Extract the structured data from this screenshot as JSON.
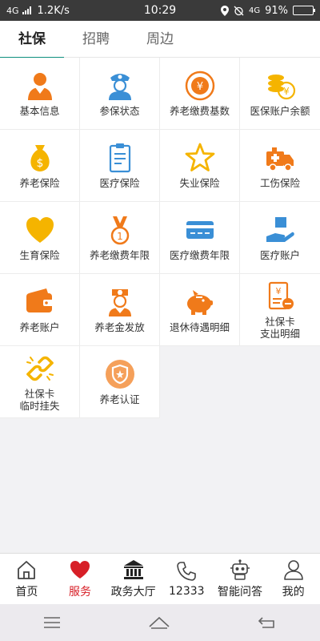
{
  "status": {
    "network": "4G",
    "speed": "1.2K/s",
    "time": "10:29",
    "network2": "4G",
    "battery": "91%",
    "battery_level": 0.91
  },
  "tabs": [
    {
      "label": "社保",
      "active": true
    },
    {
      "label": "招聘",
      "active": false
    },
    {
      "label": "周边",
      "active": false
    }
  ],
  "services": [
    {
      "label": "基本信息",
      "icon": "person-icon"
    },
    {
      "label": "参保状态",
      "icon": "officer-icon"
    },
    {
      "label": "养老缴费基数",
      "icon": "yen-circle-icon"
    },
    {
      "label": "医保账户余额",
      "icon": "coins-icon"
    },
    {
      "label": "养老保险",
      "icon": "money-bag-icon"
    },
    {
      "label": "医疗保险",
      "icon": "clipboard-icon"
    },
    {
      "label": "失业保险",
      "icon": "star-icon"
    },
    {
      "label": "工伤保险",
      "icon": "ambulance-icon"
    },
    {
      "label": "生育保险",
      "icon": "heart-icon"
    },
    {
      "label": "养老缴费年限",
      "icon": "medal-icon"
    },
    {
      "label": "医疗缴费年限",
      "icon": "card-icon"
    },
    {
      "label": "医疗账户",
      "icon": "hand-box-icon"
    },
    {
      "label": "养老账户",
      "icon": "wallet-icon"
    },
    {
      "label": "养老金发放",
      "icon": "nurse-icon"
    },
    {
      "label": "退休待遇明细",
      "icon": "piggy-bank-icon"
    },
    {
      "label": "社保卡\n支出明细",
      "icon": "receipt-icon"
    },
    {
      "label": "社保卡\n临时挂失",
      "icon": "broken-link-icon"
    },
    {
      "label": "养老认证",
      "icon": "shield-circle-icon"
    }
  ],
  "bottom_nav": [
    {
      "label": "首页",
      "icon": "home-icon",
      "active": false
    },
    {
      "label": "服务",
      "icon": "heart-icon",
      "active": true
    },
    {
      "label": "政务大厅",
      "icon": "building-icon",
      "active": false
    },
    {
      "label": "12333",
      "icon": "phone-icon",
      "active": false
    },
    {
      "label": "智能问答",
      "icon": "robot-icon",
      "active": false
    },
    {
      "label": "我的",
      "icon": "user-icon",
      "active": false
    }
  ],
  "colors": {
    "accent_teal": "#0d8f7e",
    "active_red": "#d71f27",
    "icon_orange": "#f07a1a",
    "icon_blue": "#3a8fd6",
    "icon_yellow": "#f5b400"
  }
}
